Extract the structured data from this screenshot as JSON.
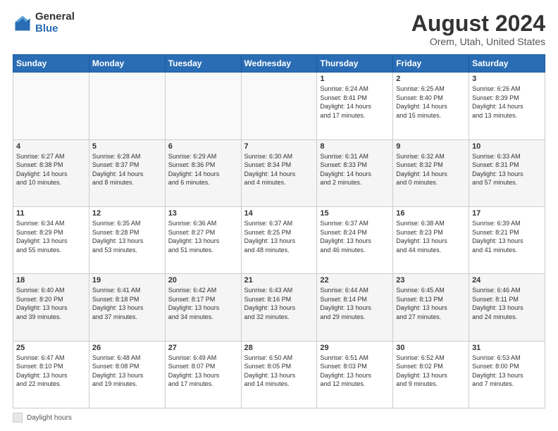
{
  "logo": {
    "general": "General",
    "blue": "Blue"
  },
  "header": {
    "title": "August 2024",
    "subtitle": "Orem, Utah, United States"
  },
  "days_of_week": [
    "Sunday",
    "Monday",
    "Tuesday",
    "Wednesday",
    "Thursday",
    "Friday",
    "Saturday"
  ],
  "weeks": [
    [
      {
        "day": "",
        "info": ""
      },
      {
        "day": "",
        "info": ""
      },
      {
        "day": "",
        "info": ""
      },
      {
        "day": "",
        "info": ""
      },
      {
        "day": "1",
        "info": "Sunrise: 6:24 AM\nSunset: 8:41 PM\nDaylight: 14 hours\nand 17 minutes."
      },
      {
        "day": "2",
        "info": "Sunrise: 6:25 AM\nSunset: 8:40 PM\nDaylight: 14 hours\nand 15 minutes."
      },
      {
        "day": "3",
        "info": "Sunrise: 6:26 AM\nSunset: 8:39 PM\nDaylight: 14 hours\nand 13 minutes."
      }
    ],
    [
      {
        "day": "4",
        "info": "Sunrise: 6:27 AM\nSunset: 8:38 PM\nDaylight: 14 hours\nand 10 minutes."
      },
      {
        "day": "5",
        "info": "Sunrise: 6:28 AM\nSunset: 8:37 PM\nDaylight: 14 hours\nand 8 minutes."
      },
      {
        "day": "6",
        "info": "Sunrise: 6:29 AM\nSunset: 8:36 PM\nDaylight: 14 hours\nand 6 minutes."
      },
      {
        "day": "7",
        "info": "Sunrise: 6:30 AM\nSunset: 8:34 PM\nDaylight: 14 hours\nand 4 minutes."
      },
      {
        "day": "8",
        "info": "Sunrise: 6:31 AM\nSunset: 8:33 PM\nDaylight: 14 hours\nand 2 minutes."
      },
      {
        "day": "9",
        "info": "Sunrise: 6:32 AM\nSunset: 8:32 PM\nDaylight: 14 hours\nand 0 minutes."
      },
      {
        "day": "10",
        "info": "Sunrise: 6:33 AM\nSunset: 8:31 PM\nDaylight: 13 hours\nand 57 minutes."
      }
    ],
    [
      {
        "day": "11",
        "info": "Sunrise: 6:34 AM\nSunset: 8:29 PM\nDaylight: 13 hours\nand 55 minutes."
      },
      {
        "day": "12",
        "info": "Sunrise: 6:35 AM\nSunset: 8:28 PM\nDaylight: 13 hours\nand 53 minutes."
      },
      {
        "day": "13",
        "info": "Sunrise: 6:36 AM\nSunset: 8:27 PM\nDaylight: 13 hours\nand 51 minutes."
      },
      {
        "day": "14",
        "info": "Sunrise: 6:37 AM\nSunset: 8:25 PM\nDaylight: 13 hours\nand 48 minutes."
      },
      {
        "day": "15",
        "info": "Sunrise: 6:37 AM\nSunset: 8:24 PM\nDaylight: 13 hours\nand 46 minutes."
      },
      {
        "day": "16",
        "info": "Sunrise: 6:38 AM\nSunset: 8:23 PM\nDaylight: 13 hours\nand 44 minutes."
      },
      {
        "day": "17",
        "info": "Sunrise: 6:39 AM\nSunset: 8:21 PM\nDaylight: 13 hours\nand 41 minutes."
      }
    ],
    [
      {
        "day": "18",
        "info": "Sunrise: 6:40 AM\nSunset: 8:20 PM\nDaylight: 13 hours\nand 39 minutes."
      },
      {
        "day": "19",
        "info": "Sunrise: 6:41 AM\nSunset: 8:18 PM\nDaylight: 13 hours\nand 37 minutes."
      },
      {
        "day": "20",
        "info": "Sunrise: 6:42 AM\nSunset: 8:17 PM\nDaylight: 13 hours\nand 34 minutes."
      },
      {
        "day": "21",
        "info": "Sunrise: 6:43 AM\nSunset: 8:16 PM\nDaylight: 13 hours\nand 32 minutes."
      },
      {
        "day": "22",
        "info": "Sunrise: 6:44 AM\nSunset: 8:14 PM\nDaylight: 13 hours\nand 29 minutes."
      },
      {
        "day": "23",
        "info": "Sunrise: 6:45 AM\nSunset: 8:13 PM\nDaylight: 13 hours\nand 27 minutes."
      },
      {
        "day": "24",
        "info": "Sunrise: 6:46 AM\nSunset: 8:11 PM\nDaylight: 13 hours\nand 24 minutes."
      }
    ],
    [
      {
        "day": "25",
        "info": "Sunrise: 6:47 AM\nSunset: 8:10 PM\nDaylight: 13 hours\nand 22 minutes."
      },
      {
        "day": "26",
        "info": "Sunrise: 6:48 AM\nSunset: 8:08 PM\nDaylight: 13 hours\nand 19 minutes."
      },
      {
        "day": "27",
        "info": "Sunrise: 6:49 AM\nSunset: 8:07 PM\nDaylight: 13 hours\nand 17 minutes."
      },
      {
        "day": "28",
        "info": "Sunrise: 6:50 AM\nSunset: 8:05 PM\nDaylight: 13 hours\nand 14 minutes."
      },
      {
        "day": "29",
        "info": "Sunrise: 6:51 AM\nSunset: 8:03 PM\nDaylight: 13 hours\nand 12 minutes."
      },
      {
        "day": "30",
        "info": "Sunrise: 6:52 AM\nSunset: 8:02 PM\nDaylight: 13 hours\nand 9 minutes."
      },
      {
        "day": "31",
        "info": "Sunrise: 6:53 AM\nSunset: 8:00 PM\nDaylight: 13 hours\nand 7 minutes."
      }
    ]
  ],
  "legend": {
    "text": "Daylight hours"
  }
}
